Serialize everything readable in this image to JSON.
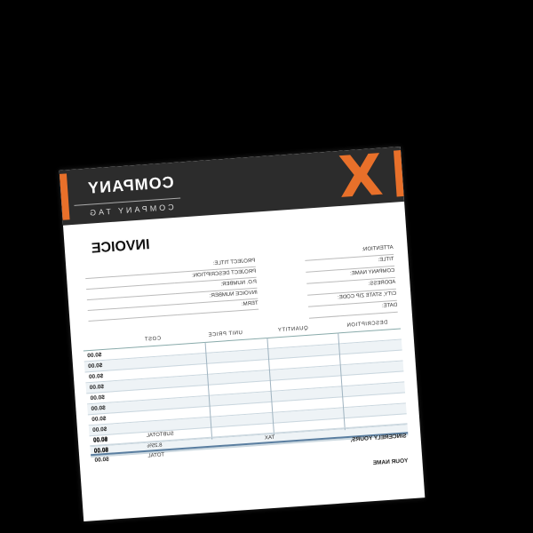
{
  "header": {
    "company": "COMPANY",
    "company_tag": "COMPANY TAG",
    "logo_letter": "X",
    "accent_color": "#e8702a",
    "band_color": "#2c2c2c"
  },
  "invoice": {
    "title": "INVOICE",
    "left_fields": [
      "ATTENTION:",
      "TITLE:",
      "COMPANY NAME:",
      "ADDRESS:",
      "CITY, STATE ZIP CODE:",
      "DATE:"
    ],
    "mid_fields": [
      "PROJECT TITLE:",
      "PROJECT DESCRIPTION:",
      "P.O. NUMBER:",
      "INVOICE NUMBER:",
      "TERM:"
    ]
  },
  "table": {
    "headers": {
      "description": "DESCRIPTION",
      "quantity": "QUANTITY",
      "unit_price": "UNIT PRICE",
      "cost": "COST"
    },
    "rows": [
      {
        "cost": "$0.00"
      },
      {
        "cost": "$0.00"
      },
      {
        "cost": "$0.00"
      },
      {
        "cost": "$0.00"
      },
      {
        "cost": "$0.00"
      },
      {
        "cost": "$0.00"
      },
      {
        "cost": "$0.00"
      },
      {
        "cost": "$0.00"
      },
      {
        "cost": "$0.00"
      },
      {
        "cost": "$0.00"
      }
    ]
  },
  "summary": {
    "subtotal_label": "SUBTOTAL",
    "subtotal": "$0.00",
    "tax_label": "TAX",
    "tax_rate": "8.25%",
    "tax": "$0.00",
    "total_label": "TOTAL",
    "total": "$0.00"
  },
  "closing": {
    "sincerely": "SINCERELY YOURS,",
    "your_name": "YOUR NAME"
  }
}
